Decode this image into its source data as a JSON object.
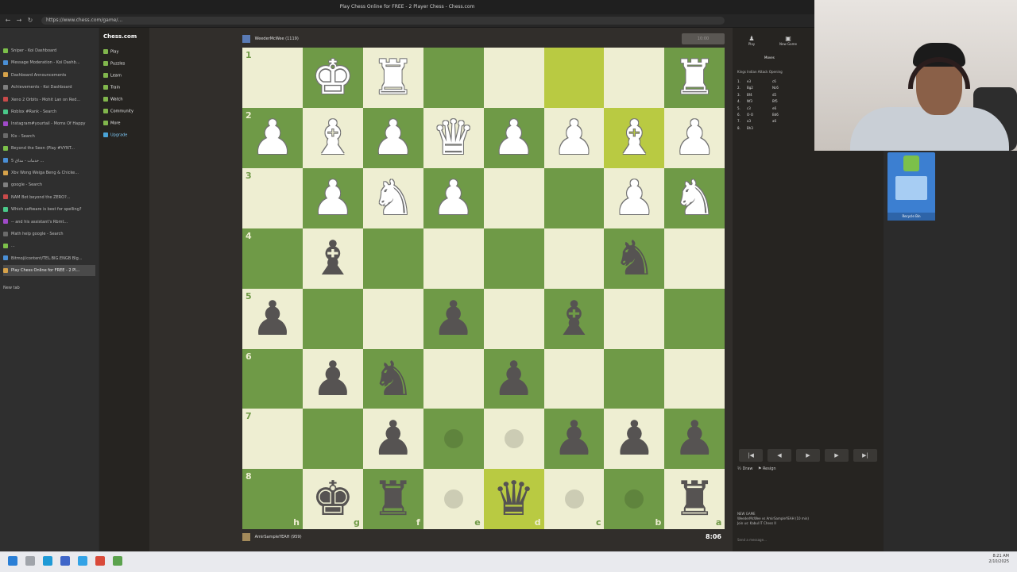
{
  "browser": {
    "window_title": "Play Chess Online for FREE - 2 Player Chess - Chess.com",
    "url": "https://www.chess.com/game/...",
    "tabs": [
      {
        "label": "Sniper - Koi Dashboard",
        "active": false
      },
      {
        "label": "Message Moderation - Koi Dashb...",
        "active": false
      },
      {
        "label": "Dashboard Announcements",
        "active": false
      },
      {
        "label": "Achievements - Koi Dashboard",
        "active": false
      },
      {
        "label": "Xeno 2 Orbits - Mohit Lan on Red...",
        "active": false
      },
      {
        "label": "Roblox #Rank - Search",
        "active": false
      },
      {
        "label": "Instagram#yourtail - Moms Of Happy",
        "active": false
      },
      {
        "label": "Kix - Search",
        "active": false
      },
      {
        "label": "Beyond the Seen (Play #VYNT...",
        "active": false
      },
      {
        "label": "خدمات - مذاق 5 ...",
        "active": false
      },
      {
        "label": "Xbv Wong Weiga Beng & Chicke...",
        "active": false
      },
      {
        "label": "google - Search",
        "active": false
      },
      {
        "label": "NAM Bot beyond the ZERO?...",
        "active": false
      },
      {
        "label": "Which software is best for spelling?",
        "active": false
      },
      {
        "label": "-- and his assistant's Rbmt...",
        "active": false
      },
      {
        "label": "Math help google - Search",
        "active": false
      },
      {
        "label": "...",
        "active": false
      },
      {
        "label": "Bitmoji/content/TEL.BIG.ENGB Blg...",
        "active": false
      },
      {
        "label": "Play Chess Online for FREE - 2 Pl...",
        "active": true
      }
    ],
    "new_tab": "New tab"
  },
  "chess_nav": {
    "logo": "Chess.com",
    "items": [
      "Play",
      "Puzzles",
      "Learn",
      "Train",
      "Watch",
      "Community",
      "More",
      "Upgrade"
    ]
  },
  "players": {
    "top": {
      "name": "WeederMcWee",
      "rating": "(1119)",
      "clock": "10:00"
    },
    "bottom": {
      "name": "AmirSampleYEAH",
      "rating": "(959)",
      "clock": "8:06"
    }
  },
  "board": {
    "ranks": [
      "1",
      "2",
      "3",
      "4",
      "5",
      "6",
      "7",
      "8"
    ],
    "files": [
      "h",
      "g",
      "f",
      "e",
      "d",
      "c",
      "b",
      "a"
    ],
    "rows": [
      [
        "",
        "wK",
        "wR",
        "",
        "",
        "",
        "",
        "wR"
      ],
      [
        "wP",
        "wB",
        "wP",
        "wQ",
        "wP",
        "wP",
        "wB",
        "wP"
      ],
      [
        "",
        "wP",
        "wN",
        "wP",
        "",
        "",
        "wP",
        "wN"
      ],
      [
        "",
        "bB",
        "",
        "",
        "",
        "",
        "bN",
        ""
      ],
      [
        "bP",
        "",
        "",
        "bP",
        "",
        "bB",
        "",
        ""
      ],
      [
        "",
        "bP",
        "bN",
        "",
        "bP",
        "",
        "",
        ""
      ],
      [
        "",
        "",
        "bP",
        "",
        "",
        "bP",
        "bP",
        "bP"
      ],
      [
        "",
        "bK",
        "bR",
        "",
        "bQ",
        "",
        "",
        "bR"
      ]
    ],
    "highlights": [
      [
        0,
        5
      ],
      [
        1,
        6
      ],
      [
        7,
        4
      ]
    ],
    "hints": [
      [
        6,
        3
      ],
      [
        6,
        4
      ],
      [
        7,
        3
      ],
      [
        7,
        5
      ],
      [
        7,
        6
      ]
    ]
  },
  "right_panel": {
    "tabs": [
      "Play",
      "New Game"
    ],
    "sub_tab": "Moves",
    "opening": "Kings Indian Attack Opening",
    "moves": [
      {
        "n": "1.",
        "w": "e3",
        "b": "c6"
      },
      {
        "n": "2.",
        "w": "Bg2",
        "b": "Nc6"
      },
      {
        "n": "3.",
        "w": "Bf4",
        "b": "d5"
      },
      {
        "n": "4.",
        "w": "Nf3",
        "b": "Bf5"
      },
      {
        "n": "5.",
        "w": "c3",
        "b": "e6"
      },
      {
        "n": "6.",
        "w": "O-O",
        "b": "Bd6"
      },
      {
        "n": "7.",
        "w": "a3",
        "b": "a6"
      },
      {
        "n": "8.",
        "w": "Bh3",
        "b": ""
      }
    ],
    "controls": [
      "|◀",
      "◀",
      "▶",
      "▶",
      "▶|"
    ],
    "draw_label": "Draw",
    "resign_label": "Resign",
    "chat_lines": [
      "NEW GAME",
      "WeederMcWee vs AmirSampleYEAH (10 min)",
      "Join us: Kabul IT Chess II"
    ],
    "chat_placeholder": "Send a message..."
  },
  "desktop": {
    "widget_label": "Recycle Bin"
  },
  "taskbar": {
    "time": "8:21 AM",
    "date": "2/10/2025"
  },
  "colors": {
    "board_light": "#eeeed2",
    "board_dark": "#6f9a47",
    "highlight": "#f5f682",
    "accent": "#81b64c"
  }
}
